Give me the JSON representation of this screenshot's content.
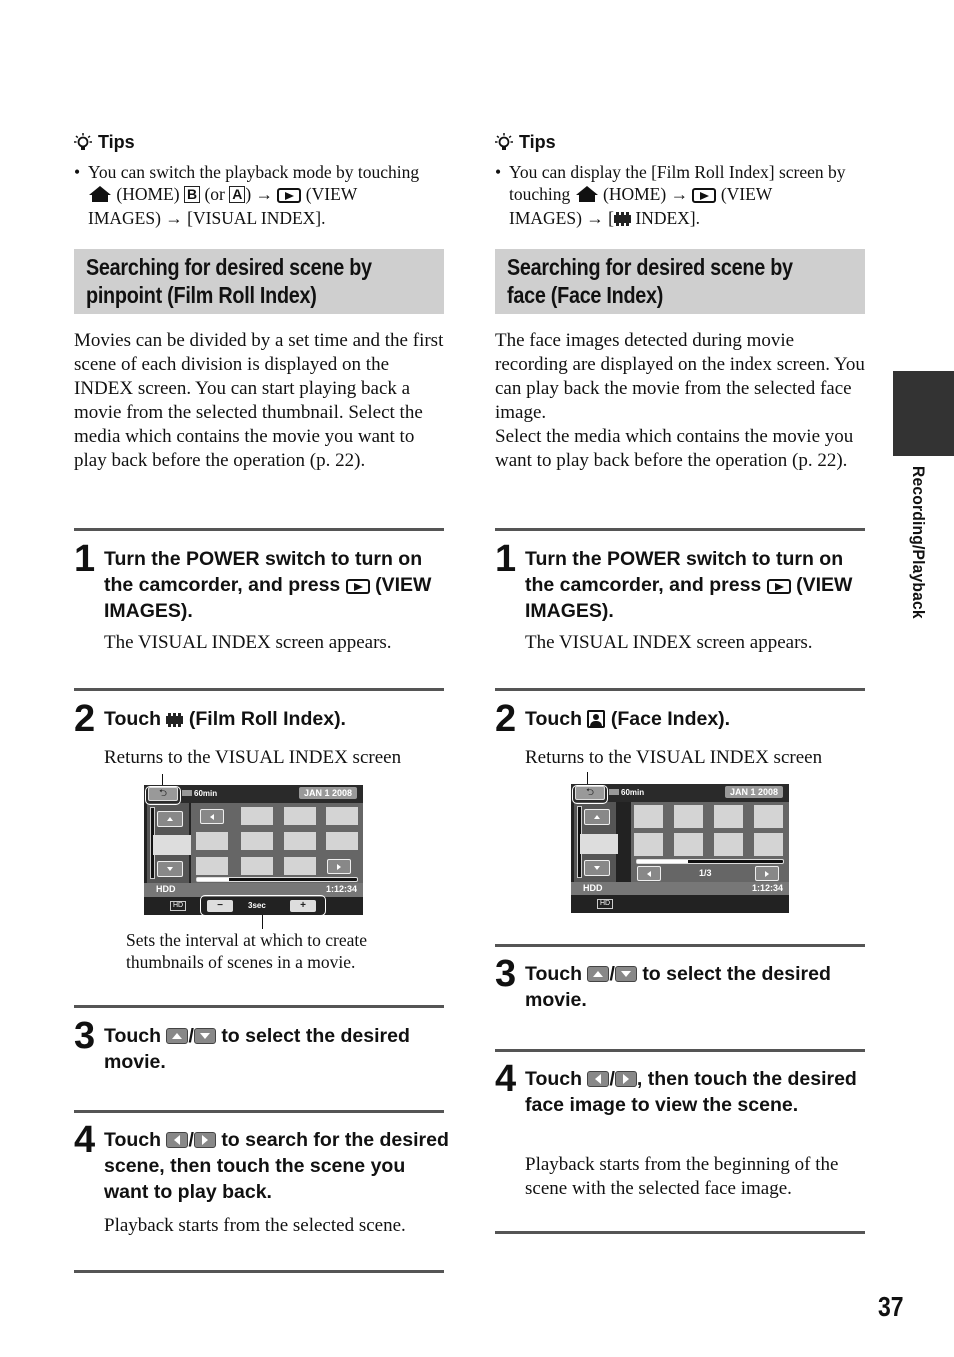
{
  "page_number": "37",
  "side_tab": {
    "label": "Recording/Playback"
  },
  "left": {
    "tips": {
      "heading": "Tips",
      "bullet": "•",
      "line1": "You can switch the playback mode by touching",
      "home_label": "(HOME)",
      "letter_b": "B",
      "or_open": "(or",
      "letter_a": "A",
      "close_paren": ")",
      "arrow": "→",
      "view_label": "(VIEW",
      "line3": "IMAGES) → [VISUAL INDEX]."
    },
    "section_title_line1": "Searching for desired scene by",
    "section_title_line2": "pinpoint (Film Roll Index)",
    "intro": "Movies can be divided by a set time and the first scene of each division is displayed on the INDEX screen. You can start playing back a movie from the selected thumbnail. Select the media which contains the movie you want to play back before the operation (p. 22).",
    "steps": [
      {
        "num": "1",
        "title_a": "Turn the POWER switch to turn on the camcorder, and press",
        "title_b": "(VIEW IMAGES).",
        "desc": "The VISUAL INDEX screen appears."
      },
      {
        "num": "2",
        "title_a": "Touch",
        "title_b": "(Film Roll Index).",
        "desc": "Returns to the VISUAL INDEX screen"
      },
      {
        "num": "3",
        "title_a": "Touch",
        "sep": "/",
        "title_b": "to select the desired movie."
      },
      {
        "num": "4",
        "title_a": "Touch",
        "sep": "/",
        "title_b": "to search for the desired scene, then touch the scene you want to play back.",
        "desc": "Playback starts from the selected scene."
      }
    ],
    "screen": {
      "back_glyph": "⮌",
      "battery": "60min",
      "date": "JAN 1 2008",
      "media": "HDD",
      "time": "1:12:34",
      "hd_badge": "HD",
      "minus": "−",
      "interval": "3sec",
      "plus": "+",
      "progress": 0.2
    },
    "caption": "Sets the interval at which to create thumbnails of scenes in a movie."
  },
  "right": {
    "tips": {
      "heading": "Tips",
      "bullet": "•",
      "line1": "You can display the [Film Roll Index] screen by",
      "touching": "touching",
      "home_label": "(HOME)",
      "arrow": "→",
      "view_label": "(VIEW",
      "line3a": "IMAGES) → [",
      "line3b": "INDEX]."
    },
    "section_title_line1": "Searching for desired scene by",
    "section_title_line2": "face (Face Index)",
    "intro": "The face images detected during movie recording are displayed on the index screen. You can play back the movie from the selected face image.",
    "intro2": "Select the media which contains the movie you want to play back before the operation (p. 22).",
    "steps": [
      {
        "num": "1",
        "title_a": "Turn the POWER switch to turn on the camcorder, and press",
        "title_b": "(VIEW IMAGES).",
        "desc": "The VISUAL INDEX screen appears."
      },
      {
        "num": "2",
        "title_a": "Touch",
        "title_b": "(Face Index).",
        "desc": "Returns to the VISUAL INDEX screen"
      },
      {
        "num": "3",
        "title_a": "Touch",
        "sep": "/",
        "title_b": "to select the desired movie."
      },
      {
        "num": "4",
        "title_a": "Touch",
        "sep": "/",
        "title_b": ", then touch the desired face image to view the scene.",
        "desc": "Playback starts from the beginning of the scene with the selected face image."
      }
    ],
    "screen": {
      "back_glyph": "⮌",
      "battery": "60min",
      "date": "JAN 1 2008",
      "media": "HDD",
      "time": "1:12:34",
      "hd_badge": "HD",
      "page": "1/3",
      "progress": 0.35
    }
  }
}
